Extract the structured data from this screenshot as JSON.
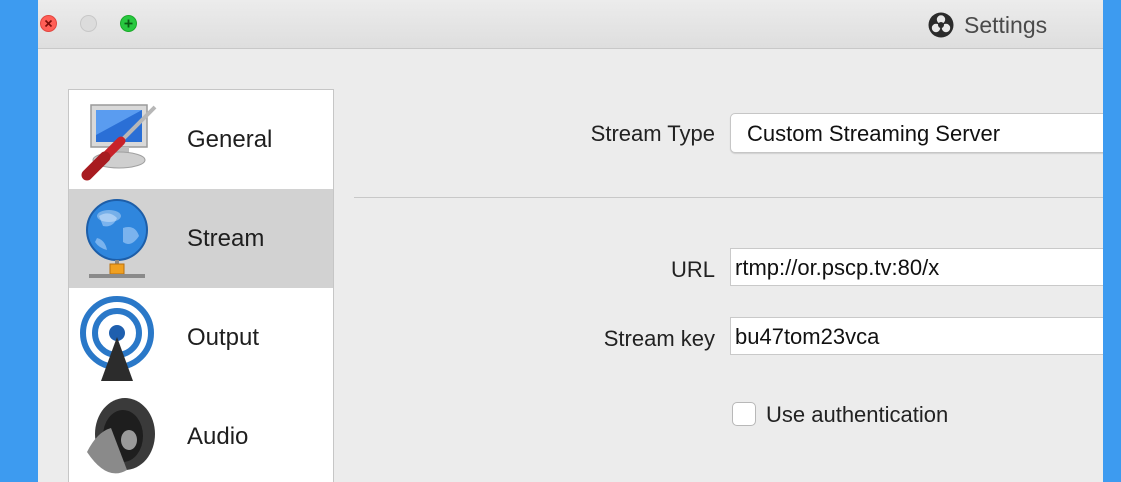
{
  "window": {
    "title": "Settings",
    "title_icon": "obs-logo-icon"
  },
  "sidebar": {
    "items": [
      {
        "label": "General",
        "icon": "screwdriver-monitor-icon",
        "selected": false
      },
      {
        "label": "Stream",
        "icon": "globe-network-icon",
        "selected": true
      },
      {
        "label": "Output",
        "icon": "broadcast-antenna-icon",
        "selected": false
      },
      {
        "label": "Audio",
        "icon": "speaker-icon",
        "selected": false
      }
    ]
  },
  "stream": {
    "type_label": "Stream Type",
    "type_value": "Custom Streaming Server",
    "url_label": "URL",
    "url_value": "rtmp://or.pscp.tv:80/x",
    "key_label": "Stream key",
    "key_value": "bu47tom23vca",
    "auth_label": "Use authentication",
    "auth_checked": false
  },
  "colors": {
    "background": "#3d9bf0",
    "window": "#ececec",
    "selected_item": "#d2d2d2"
  }
}
